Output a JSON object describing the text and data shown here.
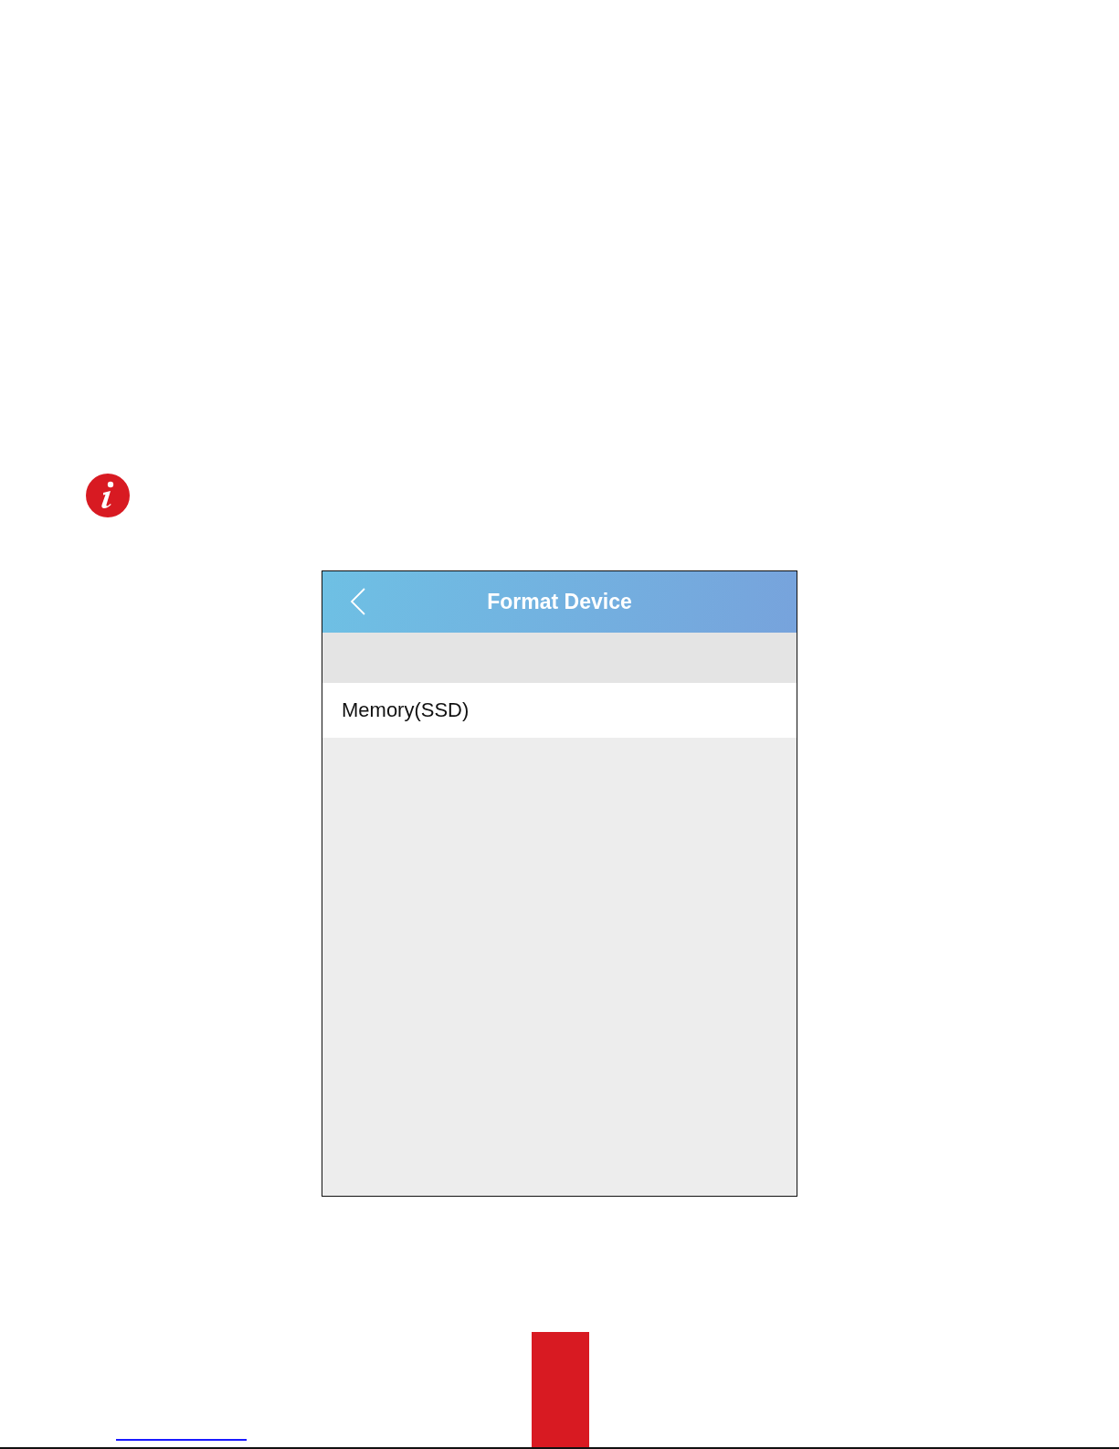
{
  "screen": {
    "title": "Format Device",
    "items": [
      {
        "label": "Memory(SSD)"
      }
    ]
  }
}
